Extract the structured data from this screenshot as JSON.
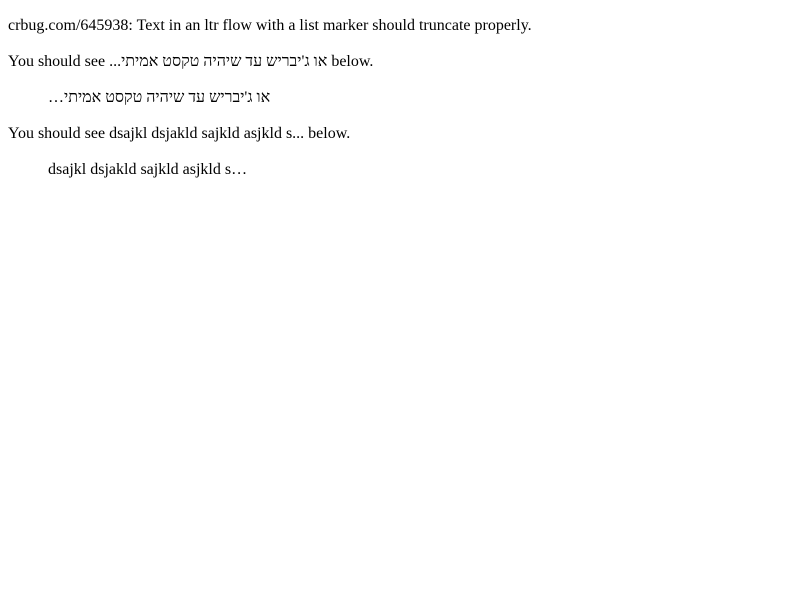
{
  "intro": "crbug.com/645938: Text in an ltr flow with a list marker should truncate properly.",
  "hebrew_section": {
    "prefix": "You should see ",
    "expected_text": "או ג'יבריש עד שיהיה טקסט אמיתי...",
    "suffix": " below.",
    "list_item": "או ג'יבריש עד שיהיה טקסט אמיתי…"
  },
  "latin_section": {
    "prefix": "You should see ",
    "expected_text": "dsajkl dsjakld sajkld asjkld s...",
    "suffix": " below.",
    "list_item": "dsajkl dsjakld sajkld asjkld s…"
  }
}
